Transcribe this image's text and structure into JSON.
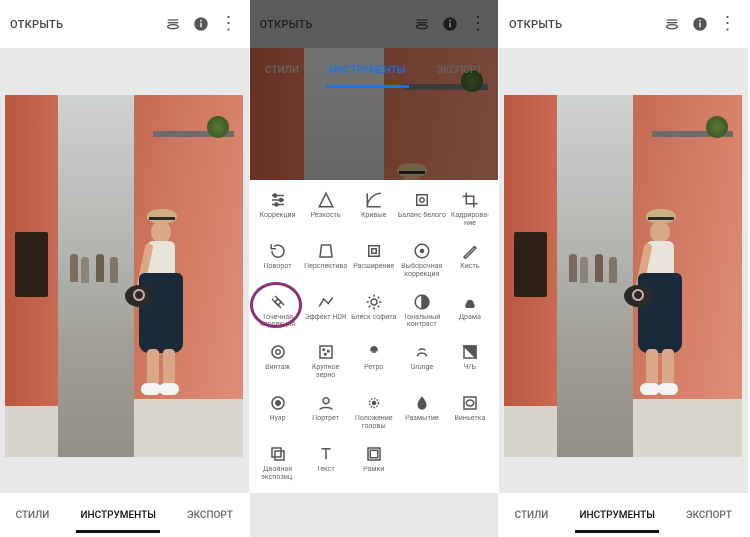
{
  "topbar": {
    "open_label": "ОТКРЫТЬ"
  },
  "tabs": {
    "styles": "СТИЛИ",
    "tools": "ИНСТРУМЕНТЫ",
    "export": "ЭКСПОРТ"
  },
  "tools": [
    {
      "id": "tune",
      "label": "Коррекция"
    },
    {
      "id": "details",
      "label": "Резкость"
    },
    {
      "id": "curves",
      "label": "Кривые"
    },
    {
      "id": "whitebalance",
      "label": "Баланс белого"
    },
    {
      "id": "crop",
      "label": "Кадрирова-ние"
    },
    {
      "id": "rotate",
      "label": "Поворот"
    },
    {
      "id": "perspective",
      "label": "Перспектива"
    },
    {
      "id": "expand",
      "label": "Расширение"
    },
    {
      "id": "selective",
      "label": "Выборочная коррекция"
    },
    {
      "id": "brush",
      "label": "Кисть"
    },
    {
      "id": "healing",
      "label": "Точечная коррекция"
    },
    {
      "id": "hdr",
      "label": "Эффект HDR"
    },
    {
      "id": "glamour",
      "label": "Блеск софита"
    },
    {
      "id": "tonalcontrast",
      "label": "Тональный контраст"
    },
    {
      "id": "drama",
      "label": "Драма"
    },
    {
      "id": "vintage",
      "label": "Винтаж"
    },
    {
      "id": "grainyfilm",
      "label": "Крупное зерно"
    },
    {
      "id": "retrolux",
      "label": "Ретро"
    },
    {
      "id": "grunge",
      "label": "Grunge"
    },
    {
      "id": "bw",
      "label": "Ч/Б"
    },
    {
      "id": "noir",
      "label": "Нуар"
    },
    {
      "id": "portrait",
      "label": "Портрет"
    },
    {
      "id": "headpose",
      "label": "Положение головы"
    },
    {
      "id": "lensblur",
      "label": "Размытие"
    },
    {
      "id": "vignette",
      "label": "Виньетка"
    },
    {
      "id": "doubleexp",
      "label": "Двойная экспозиц."
    },
    {
      "id": "text",
      "label": "Текст"
    },
    {
      "id": "frames",
      "label": "Рамки"
    }
  ],
  "highlighted_tool_index": 10
}
